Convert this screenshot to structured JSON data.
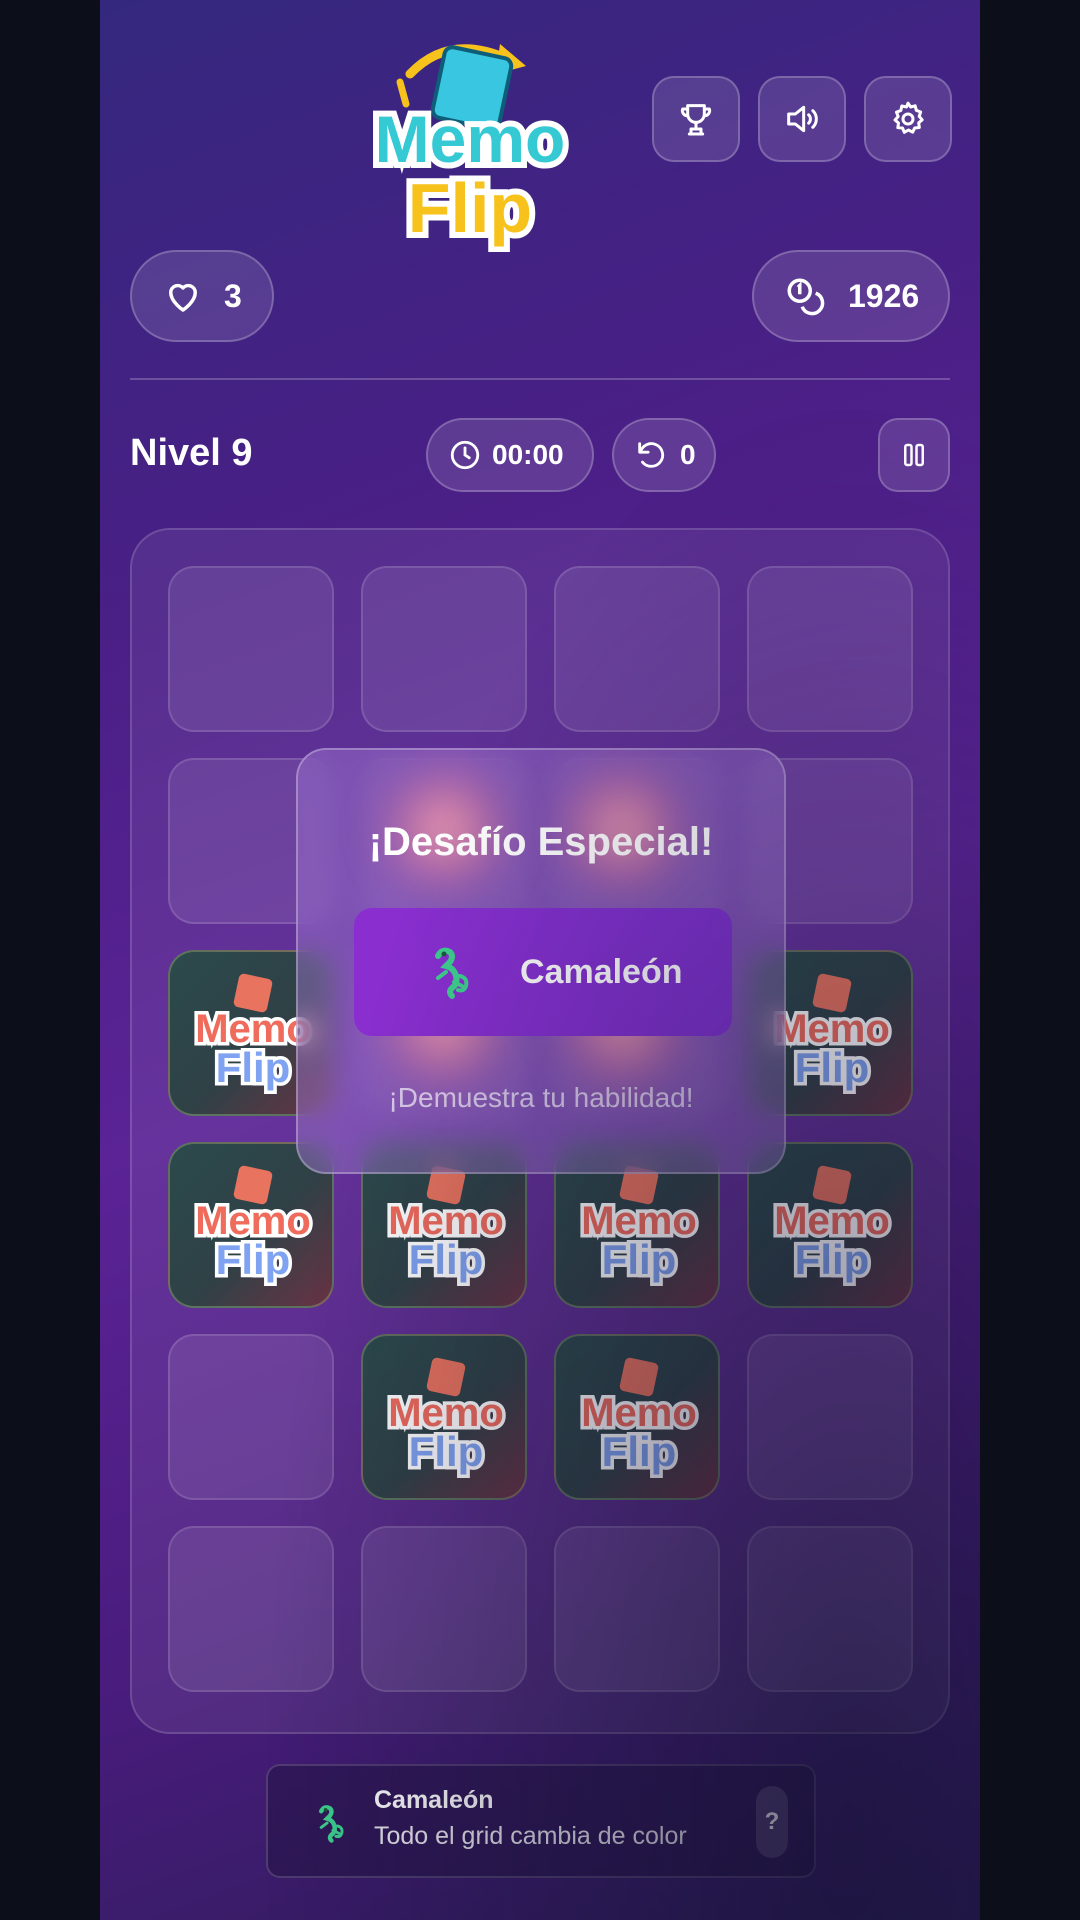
{
  "header": {
    "logo_line1": "Memo",
    "logo_line2": "Flip",
    "trophy_icon": "trophy-icon",
    "sound_icon": "volume-icon",
    "settings_icon": "gear-icon"
  },
  "stats": {
    "lives": "3",
    "coins": "1926"
  },
  "level": {
    "label": "Nivel 9",
    "timer": "00:00",
    "moves": "0"
  },
  "board": {
    "rows": 6,
    "cols": 4,
    "card_back_text": [
      "Memo",
      "Flip"
    ]
  },
  "modal": {
    "title": "¡Desafío Especial!",
    "challenge_name": "Camaleón",
    "challenge_icon": "chameleon-icon",
    "subtitle": "¡Demuestra tu habilidad!"
  },
  "info": {
    "title": "Camaleón",
    "description": "Todo el grid cambia de color",
    "help_label": "?"
  },
  "colors": {
    "accent": "#8b2ecf",
    "chameleon": "#3ecf8e",
    "logo_teal": "#35c9d4",
    "logo_yellow": "#f6c21b"
  }
}
